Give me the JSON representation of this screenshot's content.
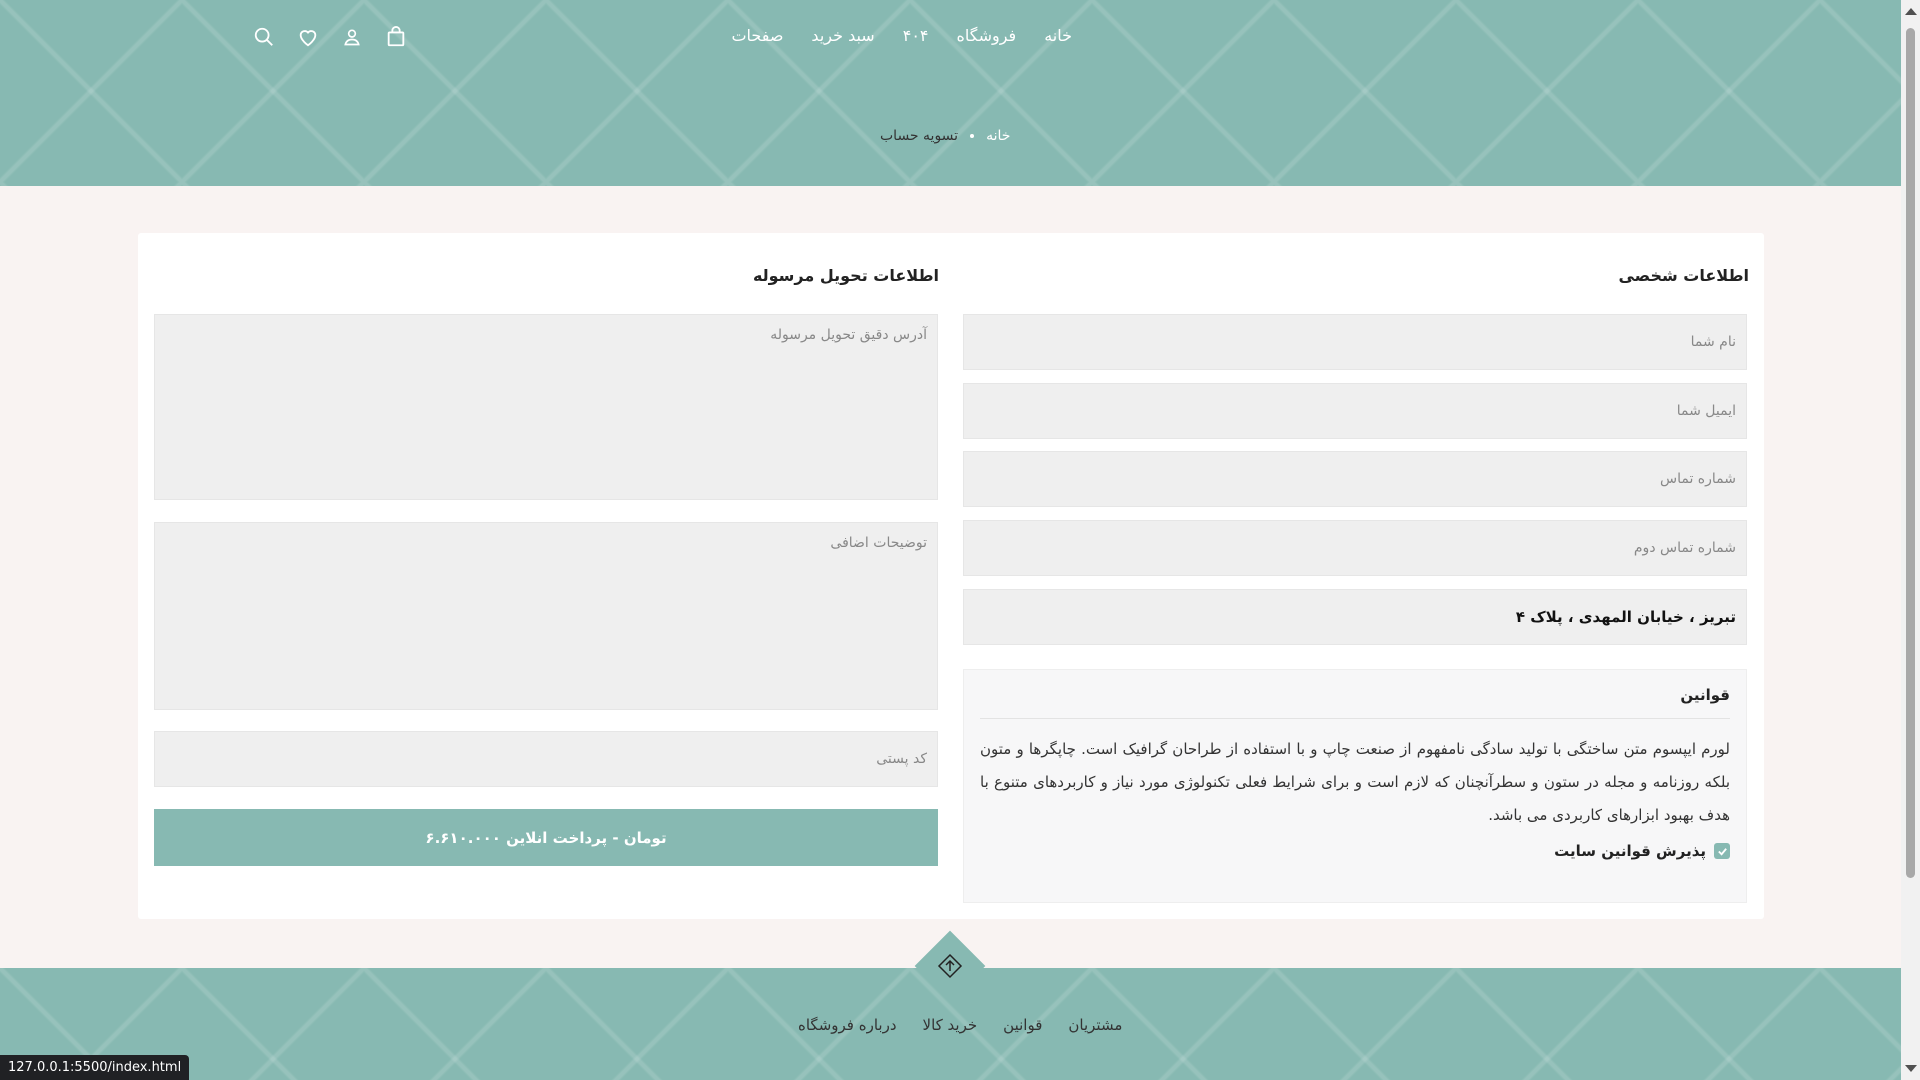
{
  "header": {
    "nav": [
      "خانه",
      "فروشگاه",
      "۴۰۴",
      "سبد خرید",
      "صفحات"
    ],
    "icons": [
      "search-icon",
      "heart-icon",
      "user-icon",
      "shopping-bag-icon"
    ]
  },
  "breadcrumb": {
    "home": "خانه",
    "current": "تسویه حساب"
  },
  "personal": {
    "title": "اطلاعات شخصی",
    "name_placeholder": "نام شما",
    "email_placeholder": "ایمیل شما",
    "phone_placeholder": "شماره تماس",
    "phone2_placeholder": "شماره تماس دوم",
    "address_value": "تبریز ، خیابان المهدی ، پلاک ۴"
  },
  "delivery": {
    "title": "اطلاعات تحویل مرسوله",
    "address_placeholder": "آدرس دقیق تحویل مرسوله",
    "notes_placeholder": "توضیحات اضافی",
    "postal_placeholder": "کد پستی",
    "pay_button": "۶.۶۱۰.۰۰۰ تومان - پرداخت انلاین"
  },
  "terms": {
    "title": "قوانین",
    "text": "لورم ایپسوم متن ساختگی با تولید سادگی نامفهوم از صنعت چاپ و با استفاده از طراحان گرافیک است. چاپگرها و متون بلکه روزنامه و مجله در ستون و سطرآنچنان که لازم است و برای شرایط فعلی تکنولوژی مورد نیاز و کاربردهای متنوع با هدف بهبود ابزارهای کاربردی می باشد.",
    "accept_label": "پذیرش قوانین سایت",
    "accepted": true
  },
  "footer": {
    "links": [
      "مشتریان",
      "قوانین",
      "خرید کالا",
      "درباره فروشگاه"
    ]
  },
  "status_bar": {
    "url": "127.0.0.1:5500/index.html"
  },
  "colors": {
    "accent": "#87b9b2",
    "page_bg": "#f9f3f2",
    "field_bg": "#efefef"
  }
}
